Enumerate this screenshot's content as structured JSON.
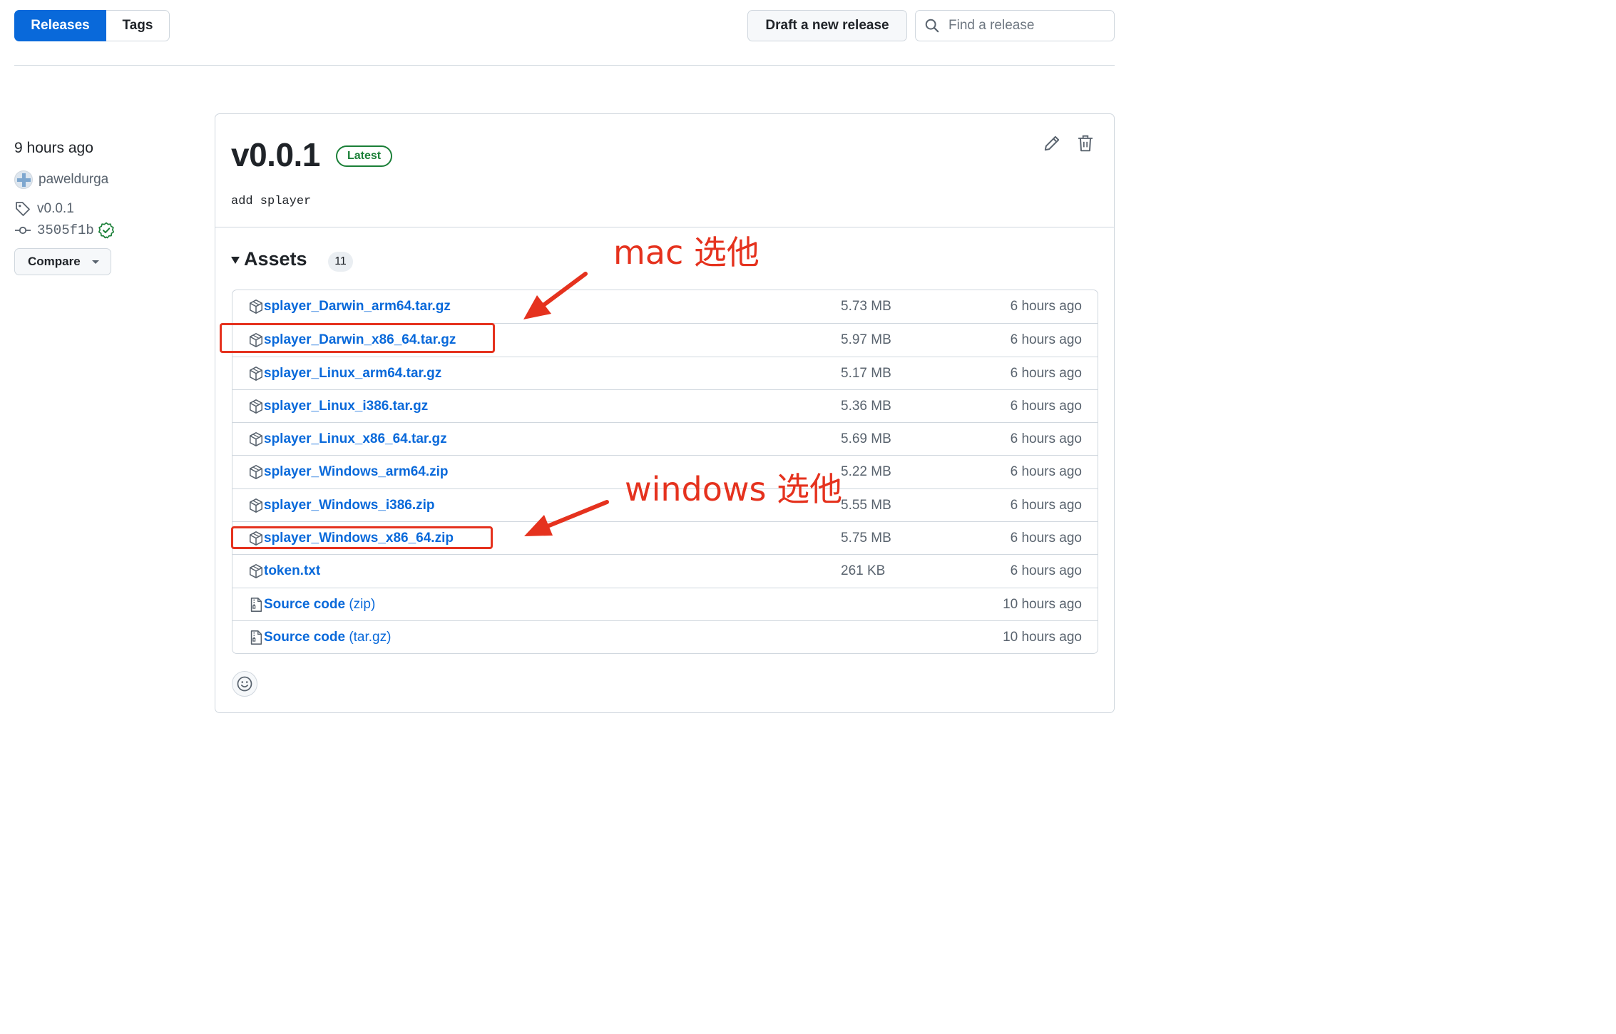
{
  "tabs": [
    {
      "label": "Releases",
      "active": true
    },
    {
      "label": "Tags",
      "active": false
    }
  ],
  "toolbar": {
    "draft_label": "Draft a new release",
    "search_placeholder": "Find a release"
  },
  "meta": {
    "time": "9 hours ago",
    "author": "paweldurga",
    "tag": "v0.0.1",
    "commit": "3505f1b",
    "compare_label": "Compare"
  },
  "release": {
    "title": "v0.0.1",
    "badge": "Latest",
    "body": "add splayer"
  },
  "assets": {
    "label": "Assets",
    "count": "11",
    "items": [
      {
        "name": "splayer_Darwin_arm64.tar.gz",
        "suffix": "",
        "size": "5.73 MB",
        "time": "6 hours ago",
        "icon": "package-icon"
      },
      {
        "name": "splayer_Darwin_x86_64.tar.gz",
        "suffix": "",
        "size": "5.97 MB",
        "time": "6 hours ago",
        "icon": "package-icon"
      },
      {
        "name": "splayer_Linux_arm64.tar.gz",
        "suffix": "",
        "size": "5.17 MB",
        "time": "6 hours ago",
        "icon": "package-icon"
      },
      {
        "name": "splayer_Linux_i386.tar.gz",
        "suffix": "",
        "size": "5.36 MB",
        "time": "6 hours ago",
        "icon": "package-icon"
      },
      {
        "name": "splayer_Linux_x86_64.tar.gz",
        "suffix": "",
        "size": "5.69 MB",
        "time": "6 hours ago",
        "icon": "package-icon"
      },
      {
        "name": "splayer_Windows_arm64.zip",
        "suffix": "",
        "size": "5.22 MB",
        "time": "6 hours ago",
        "icon": "package-icon"
      },
      {
        "name": "splayer_Windows_i386.zip",
        "suffix": "",
        "size": "5.55 MB",
        "time": "6 hours ago",
        "icon": "package-icon"
      },
      {
        "name": "splayer_Windows_x86_64.zip",
        "suffix": "",
        "size": "5.75 MB",
        "time": "6 hours ago",
        "icon": "package-icon"
      },
      {
        "name": "token.txt",
        "suffix": "",
        "size": "261 KB",
        "time": "6 hours ago",
        "icon": "package-icon"
      },
      {
        "name": "Source code",
        "suffix": " (zip)",
        "size": "",
        "time": "10 hours ago",
        "icon": "file-zip-icon"
      },
      {
        "name": "Source code",
        "suffix": " (tar.gz)",
        "size": "",
        "time": "10 hours ago",
        "icon": "file-zip-icon"
      }
    ]
  },
  "annotations": {
    "mac": "mac 选他",
    "windows": "windows 选他",
    "color": "#e5321e"
  },
  "colors": {
    "accent": "#0969da",
    "success": "#1a7f37",
    "border": "#d0d7de",
    "muted": "#59636e"
  }
}
